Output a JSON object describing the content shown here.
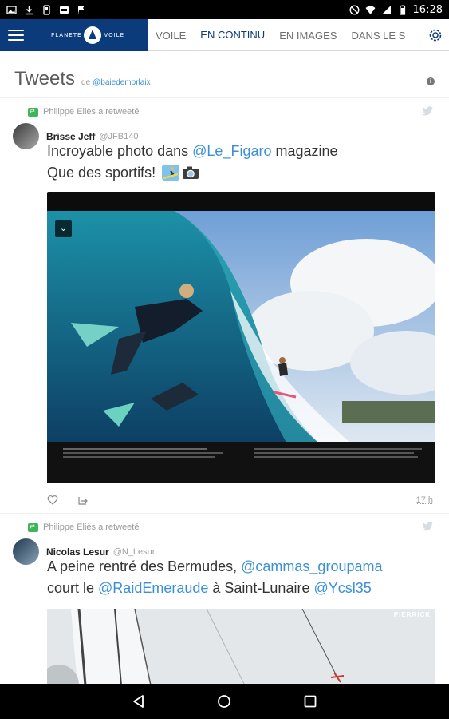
{
  "status_bar": {
    "time": "16:28"
  },
  "app_bar": {
    "logo_text_left": "PLANETE",
    "logo_text_right": "VOILE",
    "tabs": [
      {
        "label": "VOILE",
        "active": false
      },
      {
        "label": "EN CONTINU",
        "active": true
      },
      {
        "label": "EN IMAGES",
        "active": false
      },
      {
        "label": "DANS LE S",
        "active": false
      }
    ]
  },
  "header": {
    "title": "Tweets",
    "by": "de",
    "handle": "@baiedemorlaix"
  },
  "tweets": [
    {
      "retweeted_by": "Philippe Eliès a retweeté",
      "author_name": "Brisse Jeff",
      "author_handle": "@JFB140",
      "text_part1": "Incroyable photo dans ",
      "mention1": "@Le_Figaro",
      "text_part2": " magazine",
      "text_line2": "Que des sportifs!",
      "time": "17 h"
    },
    {
      "retweeted_by": "Philippe Eliès a retweeté",
      "author_name": "Nicolas Lesur",
      "author_handle": "@N_Lesur",
      "text_part1": "A peine rentré des Bermudes, ",
      "mention1": "@cammas_groupama",
      "text_part2": "court le ",
      "mention2": "@RaidEmeraude",
      "text_part3": " à Saint-Lunaire ",
      "mention3": "@Ycsl35",
      "watermark": "PIERRICK"
    }
  ],
  "colors": {
    "brand": "#0b3b7a",
    "link": "#3a8fd6",
    "retweet": "#3fb55a"
  }
}
